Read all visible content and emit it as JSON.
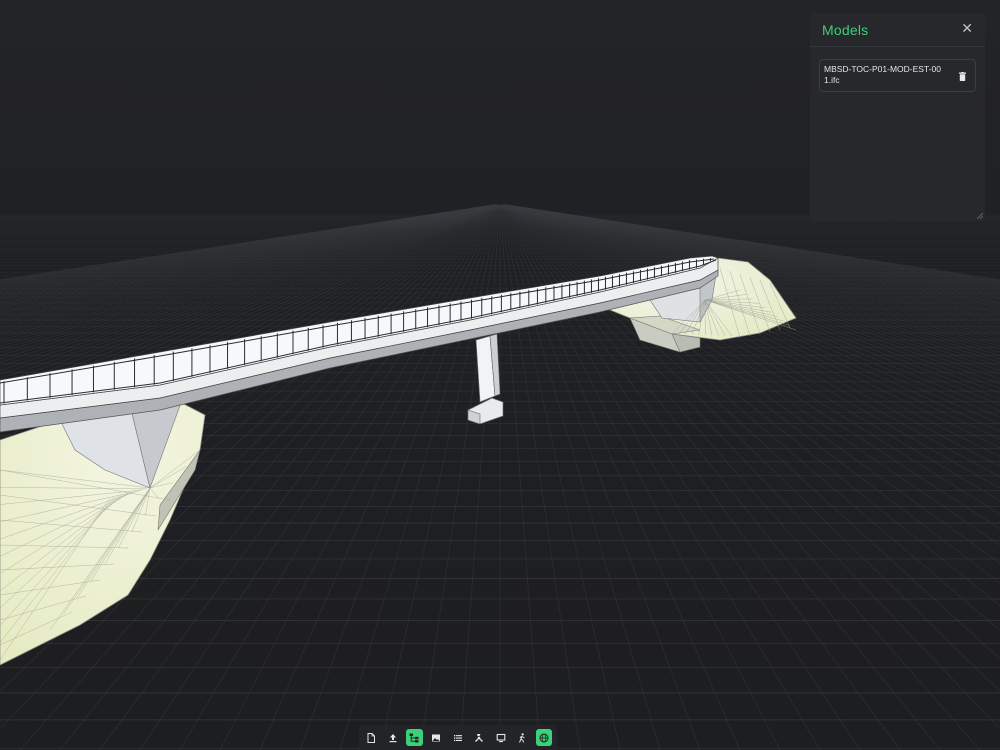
{
  "models_panel": {
    "title": "Models",
    "close_icon": "close-icon",
    "items": [
      {
        "name": "MBSD-TOC-P01-MOD-EST-001.ifc",
        "action_icon": "trash-icon"
      }
    ]
  },
  "toolbar": {
    "buttons": [
      {
        "icon": "document-icon",
        "active": false
      },
      {
        "icon": "upload-icon",
        "active": false
      },
      {
        "icon": "model-tree-icon",
        "active": true
      },
      {
        "icon": "image-icon",
        "active": false
      },
      {
        "icon": "list-icon",
        "active": false
      },
      {
        "icon": "tools-icon",
        "active": false
      },
      {
        "icon": "monitor-icon",
        "active": false
      },
      {
        "icon": "walk-icon",
        "active": false
      },
      {
        "icon": "globe-icon",
        "active": true
      }
    ]
  },
  "colors": {
    "accent": "#3ecf7a",
    "background": "#202124",
    "panel": "#26282b",
    "grid": "#3a3c40",
    "terrain": "#eef0d6"
  }
}
